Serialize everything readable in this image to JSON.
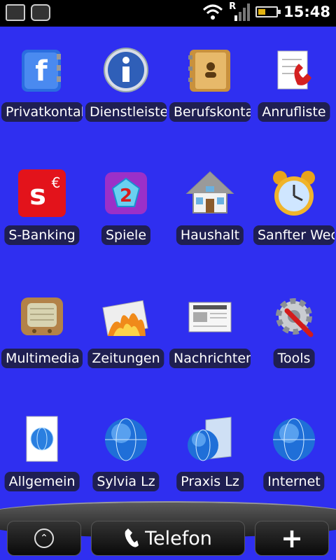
{
  "status_bar": {
    "time": "15:48",
    "roaming_indicator": "R",
    "battery_level": 0.4,
    "icons": [
      "gallery-icon",
      "camera-icon",
      "wifi-icon",
      "signal-icon",
      "battery-icon"
    ]
  },
  "apps": [
    {
      "label": "Privatkontakte",
      "icon": "contacts-book-f-icon"
    },
    {
      "label": "Dienstleister",
      "icon": "info-icon"
    },
    {
      "label": "Berufskontakte",
      "icon": "address-book-icon"
    },
    {
      "label": "Anrufliste",
      "icon": "call-log-icon"
    },
    {
      "label": "S-Banking",
      "icon": "sparkasse-icon"
    },
    {
      "label": "Spiele",
      "icon": "games-icon"
    },
    {
      "label": "Haushalt",
      "icon": "house-icon"
    },
    {
      "label": "Sanfter Wecker",
      "icon": "alarm-clock-icon"
    },
    {
      "label": "Multimedia",
      "icon": "radio-icon"
    },
    {
      "label": "Zeitungen",
      "icon": "burning-newspaper-icon"
    },
    {
      "label": "Nachrichten",
      "icon": "news-icon"
    },
    {
      "label": "Tools",
      "icon": "tools-gear-icon"
    },
    {
      "label": "Allgemein",
      "icon": "globe-document-icon"
    },
    {
      "label": "Sylvia Lz",
      "icon": "globe-icon"
    },
    {
      "label": "Praxis Lz",
      "icon": "globe-folder-icon"
    },
    {
      "label": "Internet",
      "icon": "globe-icon"
    }
  ],
  "dock": {
    "phone_label": "Telefon",
    "plus_label": "+",
    "up_label": "⌃"
  },
  "colors": {
    "background": "#2f2ff0",
    "label_bg": "#1f1f52"
  }
}
